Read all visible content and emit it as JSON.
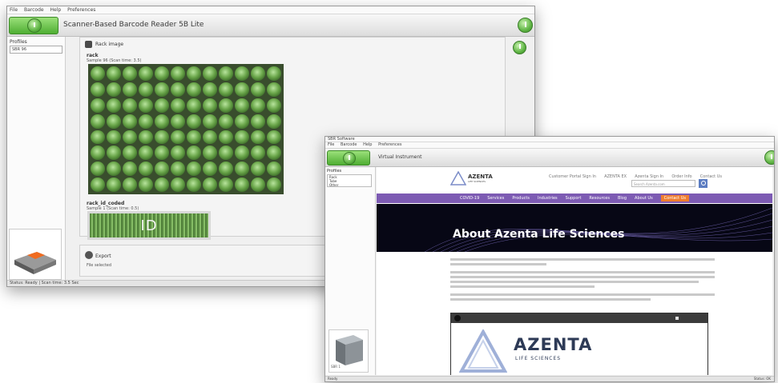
{
  "colors": {
    "accent_green": "#5fb544",
    "purple_nav": "#7d5bb3",
    "contact_orange": "#f07d2e",
    "hero_bg": "#070715"
  },
  "window1": {
    "menu": [
      "File",
      "Barcode",
      "Help",
      "Preferences"
    ],
    "title": "Scanner-Based Barcode Reader  5B Lite",
    "sidebar": {
      "profiles_label": "Profiles",
      "profile_value": "SBR 96"
    },
    "rack_image_label": "Rack image",
    "rack_id_label": "rack",
    "rack_subtext": "Sample 96 (Scan time: 3.5)",
    "rack_id_header": "rack_id_coded",
    "rack_id_sub": "Sample 1 (Scan time: 0.5)",
    "barcode_text": "ID",
    "export_label": "Export",
    "export_sub": "File selected",
    "status": "Status: Ready | Scan time: 3.5 Sec"
  },
  "window2": {
    "window_title": "SBR Software",
    "menu": [
      "File",
      "Barcode",
      "Help",
      "Preferences"
    ],
    "title": "Virtual Instrument",
    "sidebar": {
      "profiles_label": "Profiles",
      "items": [
        "Rack",
        "Tube",
        "Other"
      ]
    },
    "device_label": "SBR 1",
    "site": {
      "logo_text": "AZENTA",
      "logo_sub": "LIFE SCIENCES",
      "top_links": [
        "Customer Portal Sign In",
        "AZENTA EX",
        "Azenta Sign In",
        "Order Info",
        "Contact Us"
      ],
      "search_placeholder": "Search Azenta.com",
      "nav": [
        "COVID-19",
        "Services",
        "Products",
        "Industries",
        "Support",
        "Resources",
        "Blog",
        "About Us"
      ],
      "nav_cta": "Contact Us",
      "hero_title": "About Azenta Life Sciences",
      "video_brand": "AZENTA",
      "video_sub": "LIFE SCIENCES"
    },
    "status_left": "Ready",
    "status_right": "Status: OK"
  }
}
